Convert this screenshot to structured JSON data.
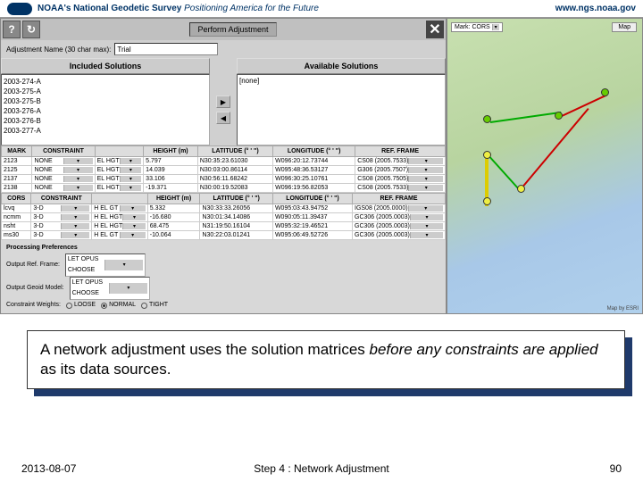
{
  "header": {
    "brand": "NOAA's",
    "title": "National Geodetic Survey",
    "tag": "Positioning America for the Future",
    "url": "www.ngs.noaa.gov"
  },
  "toolbar": {
    "main_btn": "Perform Adjustment"
  },
  "adj": {
    "label": "Adjustment Name (30 char max):",
    "value": "Trial"
  },
  "sol": {
    "inc_header": "Included Solutions",
    "avail_header": "Available Solutions",
    "included": [
      "2003-274-A",
      "2003-275-A",
      "2003-275-B",
      "2003-276-A",
      "2003-276-B",
      "2003-277-A"
    ],
    "available": "[none]"
  },
  "marks": {
    "headers": [
      "MARK",
      "CONSTRAINT",
      "",
      "HEIGHT (m)",
      "LATITUDE (° ' \")",
      "LONGITUDE (° ' \")",
      "REF. FRAME"
    ],
    "rows": [
      [
        "2123",
        "NONE",
        "EL HGT",
        "5.797",
        "N30:35:23.61030",
        "W096:20:12.73744",
        "CS08 (2005.7533)"
      ],
      [
        "2125",
        "NONE",
        "EL HGT",
        "14.039",
        "N30:03:00.86114",
        "W095:48:36.53127",
        "G306 (2005.7507)"
      ],
      [
        "2137",
        "NONE",
        "EL HGT",
        "33.106",
        "N30:56:11.68242",
        "W096:30:25.10761",
        "CS08 (2005.7505)"
      ],
      [
        "2138",
        "NONE",
        "EL HGT",
        "-19.371",
        "N30:00:19.52083",
        "W096:19:56.82053",
        "CS08 (2005.7533)"
      ]
    ]
  },
  "cors": {
    "headers": [
      "CORS",
      "CONSTRAINT",
      "",
      "HEIGHT (m)",
      "LATITUDE (° ' \")",
      "LONGITUDE (° ' \")",
      "REF. FRAME"
    ],
    "rows": [
      [
        "lcvq",
        "3-D",
        "H EL GT",
        "5.332",
        "N30:33:33.26056",
        "W095:03:43.94752",
        "IGS08 (2005.0000)"
      ],
      [
        "ncmm",
        "3-D",
        "H EL HGT",
        "-16.680",
        "N30:01:34.14086",
        "W090:05:11.39437",
        "GC306 (2005.0003)"
      ],
      [
        "nsht",
        "3-D",
        "H EL HGT",
        "68.475",
        "N31:19:50.16104",
        "W095:32:19.46521",
        "GC306 (2005.0003)"
      ],
      [
        "ms30",
        "3-D",
        "H EL GT",
        "-10.064",
        "N30:22:03.01241",
        "W095:06:49.52726",
        "GC306 (2005.0003)"
      ]
    ]
  },
  "prefs": {
    "title": "Processing Preferences",
    "r1_label": "Output Ref. Frame:",
    "r1_opt": "LET OPUS CHOOSE",
    "r2_label": "Output Geoid Model:",
    "r2_opt": "LET OPUS CHOOSE",
    "r3_label": "Constraint Weights:",
    "r3_a": "LOOSE",
    "r3_b": "NORMAL",
    "r3_c": "TIGHT"
  },
  "map": {
    "dropdown": "Mark: CORS",
    "button": "Map",
    "credit": "Map by ESRI"
  },
  "caption": {
    "t1": "A network adjustment uses the solution matrices ",
    "t2": "before any constraints are applied",
    "t3": " as its data sources."
  },
  "footer": {
    "date": "2013-08-07",
    "center": "Step 4 : Network Adjustment",
    "page": "90"
  }
}
